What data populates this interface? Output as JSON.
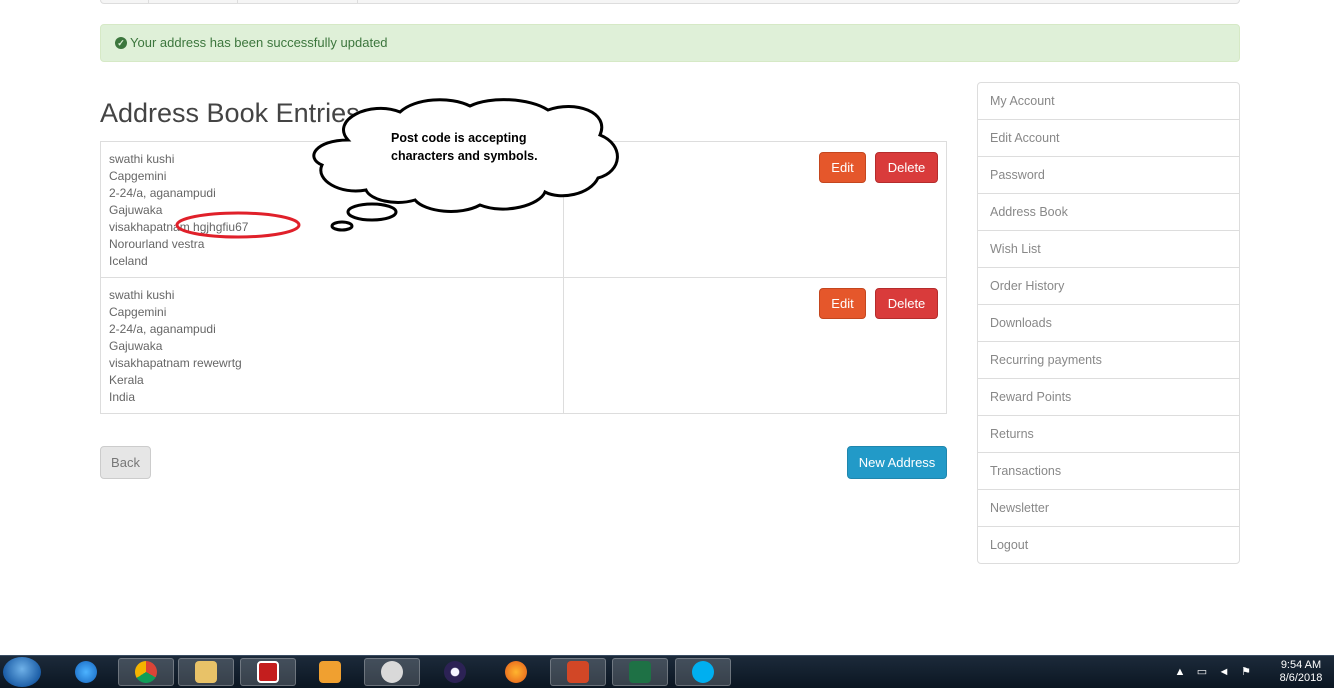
{
  "alert": {
    "message": "Your address has been successfully updated"
  },
  "page_title": "Address Book Entries",
  "addresses": [
    {
      "lines": [
        "swathi kushi",
        "Capgemini",
        "2-24/a, aganampudi",
        "Gajuwaka",
        "visakhapatnam hgjhgfiu67",
        "Norourland vestra",
        "Iceland"
      ]
    },
    {
      "lines": [
        "swathi kushi",
        "Capgemini",
        "2-24/a, aganampudi",
        "Gajuwaka",
        "visakhapatnam rewewrtg",
        "Kerala",
        "India"
      ]
    }
  ],
  "buttons": {
    "edit": "Edit",
    "delete": "Delete",
    "back": "Back",
    "new_address": "New Address"
  },
  "sidebar": {
    "items": [
      "My Account",
      "Edit Account",
      "Password",
      "Address Book",
      "Wish List",
      "Order History",
      "Downloads",
      "Recurring payments",
      "Reward Points",
      "Returns",
      "Transactions",
      "Newsletter",
      "Logout"
    ]
  },
  "annotation": {
    "text": "Post code is accepting characters and symbols."
  },
  "taskbar": {
    "apps": [
      "internet-explorer",
      "chrome",
      "file-explorer",
      "acrobat",
      "media-player",
      "snipping-tool",
      "eclipse",
      "firefox",
      "powerpoint",
      "excel",
      "skype"
    ],
    "time": "9:54 AM",
    "date": "8/6/2018"
  },
  "colors": {
    "success_bg": "#dff0d8",
    "edit": "#e5572b",
    "delete": "#d93b3b",
    "primary": "#229ac8"
  }
}
